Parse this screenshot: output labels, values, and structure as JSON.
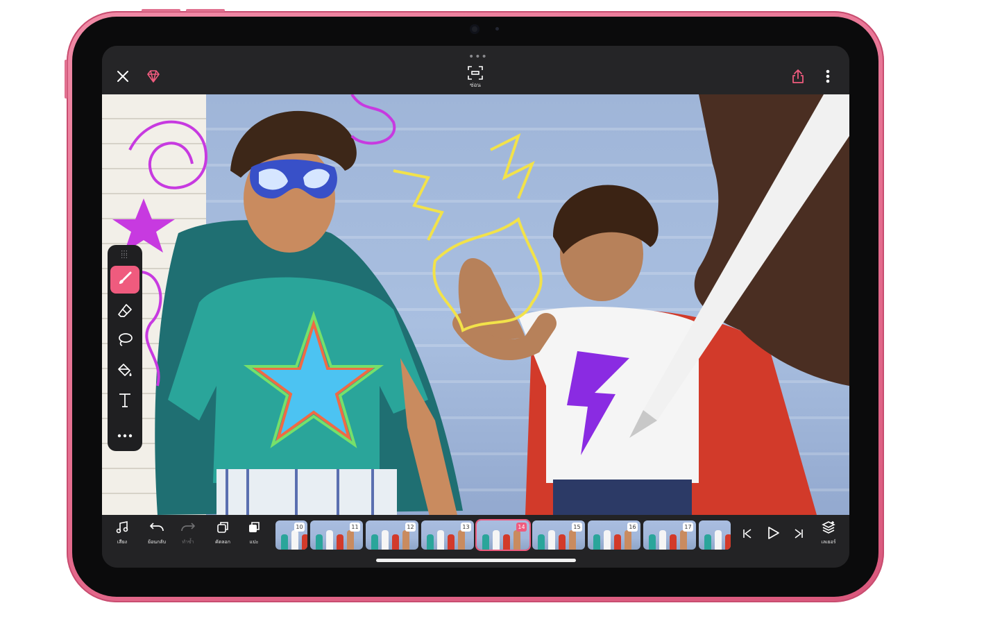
{
  "colors": {
    "accent": "#ef5b7e",
    "device": "#e46b8d",
    "toolbar": "#252527"
  },
  "topbar": {
    "close_icon": "close-icon",
    "premium_icon": "gem-icon",
    "hide_label": "ซ่อน",
    "share_icon": "share-icon",
    "more_icon": "more-vertical-icon"
  },
  "tools": [
    {
      "name": "brush",
      "icon": "brush-icon",
      "active": true
    },
    {
      "name": "eraser",
      "icon": "eraser-icon",
      "active": false
    },
    {
      "name": "lasso",
      "icon": "lasso-icon",
      "active": false
    },
    {
      "name": "fill",
      "icon": "paint-bucket-icon",
      "active": false
    },
    {
      "name": "text",
      "icon": "text-icon",
      "active": false
    },
    {
      "name": "more",
      "icon": "more-horizontal-icon",
      "active": false
    }
  ],
  "bottombar": {
    "sound_label": "เสียง",
    "undo_label": "ย้อนกลับ",
    "redo_label": "ทำซ้ำ",
    "copy_label": "คัดลอก",
    "paste_label": "แปะ",
    "layers_label": "เลเยอร์"
  },
  "frames": [
    "10",
    "11",
    "12",
    "13",
    "14",
    "15",
    "16",
    "17",
    ""
  ],
  "selected_frame": "14"
}
